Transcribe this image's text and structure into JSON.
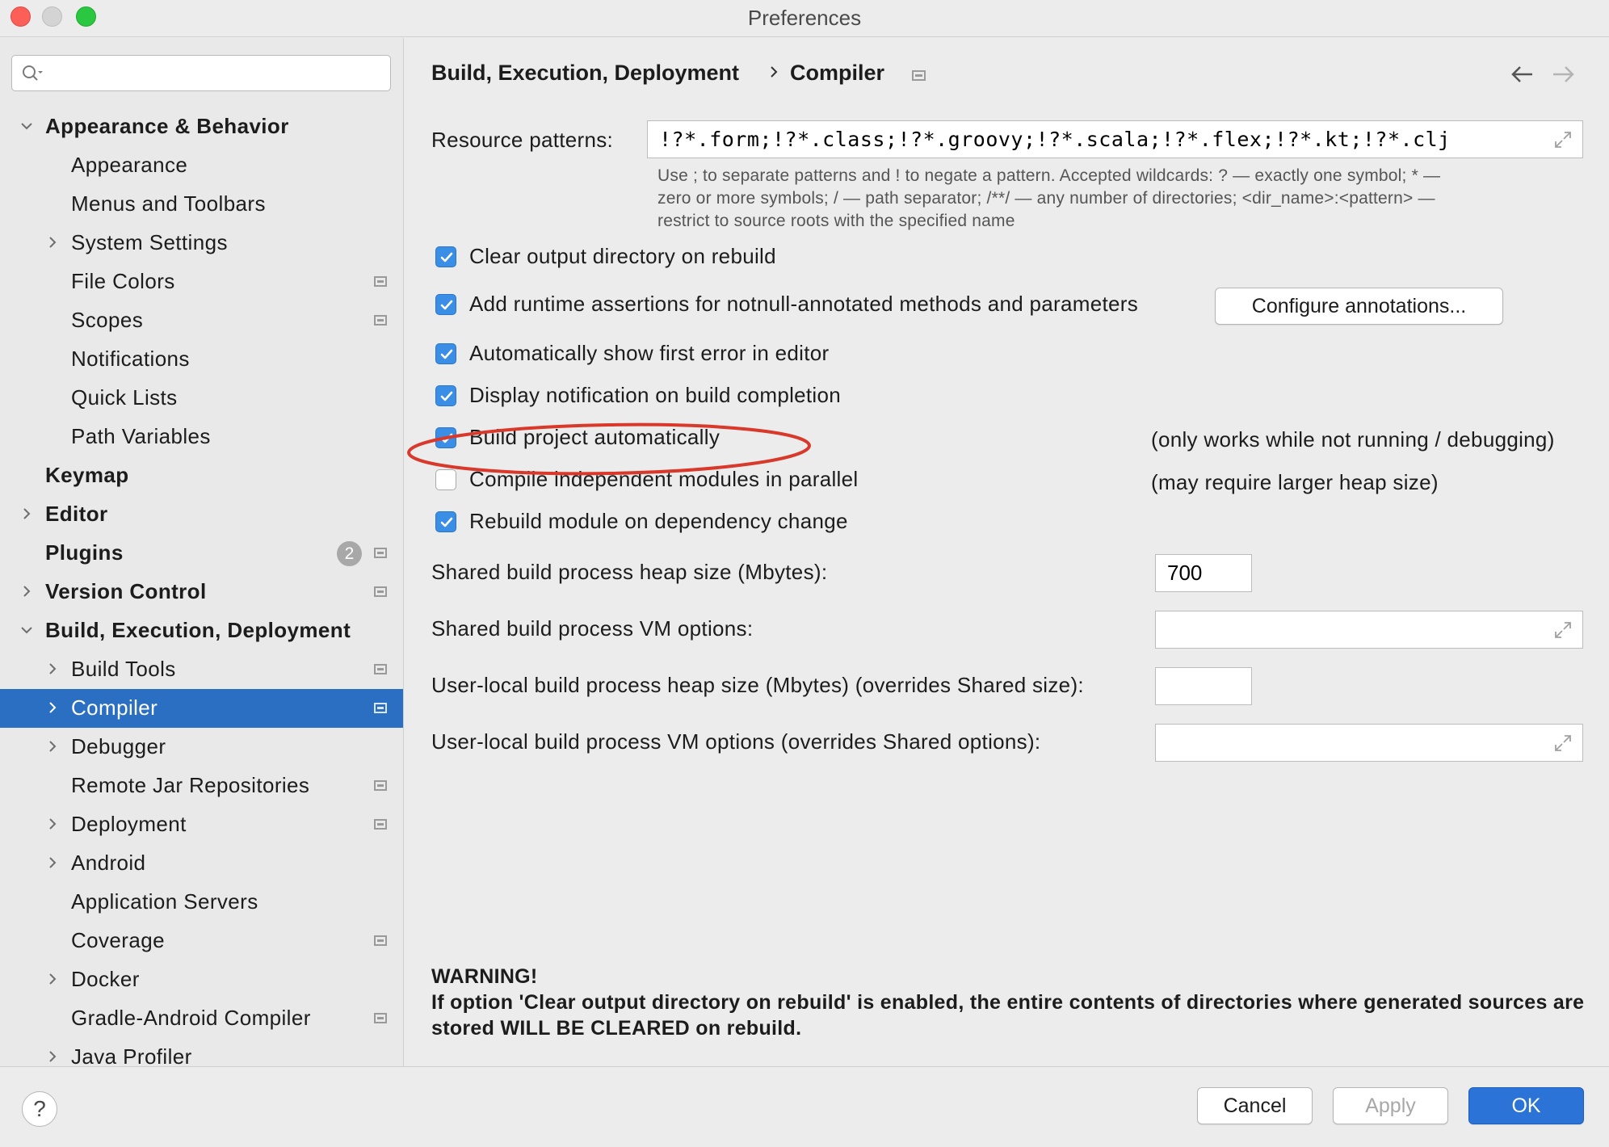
{
  "window": {
    "title": "Preferences"
  },
  "sidebar": {
    "search_placeholder": "",
    "items": [
      {
        "label": "Appearance & Behavior",
        "bold": true,
        "level": 0,
        "chevron": "down"
      },
      {
        "label": "Appearance",
        "bold": false,
        "level": 1,
        "chevron": ""
      },
      {
        "label": "Menus and Toolbars",
        "bold": false,
        "level": 1,
        "chevron": ""
      },
      {
        "label": "System Settings",
        "bold": false,
        "level": 1,
        "chevron": "right"
      },
      {
        "label": "File Colors",
        "bold": false,
        "level": 1,
        "chevron": "",
        "project_icon": true
      },
      {
        "label": "Scopes",
        "bold": false,
        "level": 1,
        "chevron": "",
        "project_icon": true
      },
      {
        "label": "Notifications",
        "bold": false,
        "level": 1,
        "chevron": ""
      },
      {
        "label": "Quick Lists",
        "bold": false,
        "level": 1,
        "chevron": ""
      },
      {
        "label": "Path Variables",
        "bold": false,
        "level": 1,
        "chevron": ""
      },
      {
        "label": "Keymap",
        "bold": true,
        "level": 0,
        "chevron": ""
      },
      {
        "label": "Editor",
        "bold": true,
        "level": 0,
        "chevron": "right"
      },
      {
        "label": "Plugins",
        "bold": true,
        "level": 0,
        "chevron": "",
        "badge": "2",
        "project_icon": true
      },
      {
        "label": "Version Control",
        "bold": true,
        "level": 0,
        "chevron": "right",
        "project_icon": true
      },
      {
        "label": "Build, Execution, Deployment",
        "bold": true,
        "level": 0,
        "chevron": "down"
      },
      {
        "label": "Build Tools",
        "bold": false,
        "level": 1,
        "chevron": "right",
        "project_icon": true
      },
      {
        "label": "Compiler",
        "bold": false,
        "level": 1,
        "chevron": "right",
        "project_icon": true,
        "selected": true
      },
      {
        "label": "Debugger",
        "bold": false,
        "level": 1,
        "chevron": "right"
      },
      {
        "label": "Remote Jar Repositories",
        "bold": false,
        "level": 1,
        "chevron": "",
        "project_icon": true
      },
      {
        "label": "Deployment",
        "bold": false,
        "level": 1,
        "chevron": "right",
        "project_icon": true
      },
      {
        "label": "Android",
        "bold": false,
        "level": 1,
        "chevron": "right"
      },
      {
        "label": "Application Servers",
        "bold": false,
        "level": 1,
        "chevron": ""
      },
      {
        "label": "Coverage",
        "bold": false,
        "level": 1,
        "chevron": "",
        "project_icon": true
      },
      {
        "label": "Docker",
        "bold": false,
        "level": 1,
        "chevron": "right"
      },
      {
        "label": "Gradle-Android Compiler",
        "bold": false,
        "level": 1,
        "chevron": "",
        "project_icon": true
      },
      {
        "label": "Java Profiler",
        "bold": false,
        "level": 1,
        "chevron": "right"
      }
    ]
  },
  "content": {
    "breadcrumb": {
      "parent": "Build, Execution, Deployment",
      "current": "Compiler"
    },
    "resource_patterns": {
      "label": "Resource patterns:",
      "value": "!?*.form;!?*.class;!?*.groovy;!?*.scala;!?*.flex;!?*.kt;!?*.clj;!?*.aj"
    },
    "hint_lines": [
      "Use ; to separate patterns and ! to negate a pattern. Accepted wildcards: ? — exactly one symbol; * —",
      "zero or more symbols; / — path separator; /**/ — any number of directories; <dir_name>:<pattern> —",
      "restrict to source roots with the specified name"
    ],
    "checkboxes": [
      {
        "label": "Clear output directory on rebuild",
        "checked": true
      },
      {
        "label": "Add runtime assertions for notnull-annotated methods and parameters",
        "checked": true
      },
      {
        "label": "Automatically show first error in editor",
        "checked": true
      },
      {
        "label": "Display notification on build completion",
        "checked": true
      },
      {
        "label": "Build project automatically",
        "checked": true
      },
      {
        "label": "Compile independent modules in parallel",
        "checked": false
      },
      {
        "label": "Rebuild module on dependency change",
        "checked": true
      }
    ],
    "configure_annotations_button": "Configure annotations...",
    "notes": {
      "build_auto": "(only works while not running / debugging)",
      "parallel": "(may require larger heap size)"
    },
    "fields": {
      "shared_heap": {
        "label": "Shared build process heap size (Mbytes):",
        "value": "700"
      },
      "shared_vm": {
        "label": "Shared build process VM options:",
        "value": ""
      },
      "local_heap": {
        "label": "User-local build process heap size (Mbytes) (overrides Shared size):",
        "value": ""
      },
      "local_vm": {
        "label": "User-local build process VM options (overrides Shared options):",
        "value": ""
      }
    },
    "warning": {
      "title": "WARNING!",
      "body": "If option 'Clear output directory on rebuild' is enabled, the entire contents of directories where generated sources are stored WILL BE CLEARED on rebuild."
    }
  },
  "buttons": {
    "help": "?",
    "cancel": "Cancel",
    "apply": "Apply",
    "ok": "OK"
  },
  "colors": {
    "selection": "#2b6fc3",
    "checkbox": "#3a8ee6",
    "highlight_ellipse": "#d8392b",
    "primary_button": "#2b73d6"
  }
}
